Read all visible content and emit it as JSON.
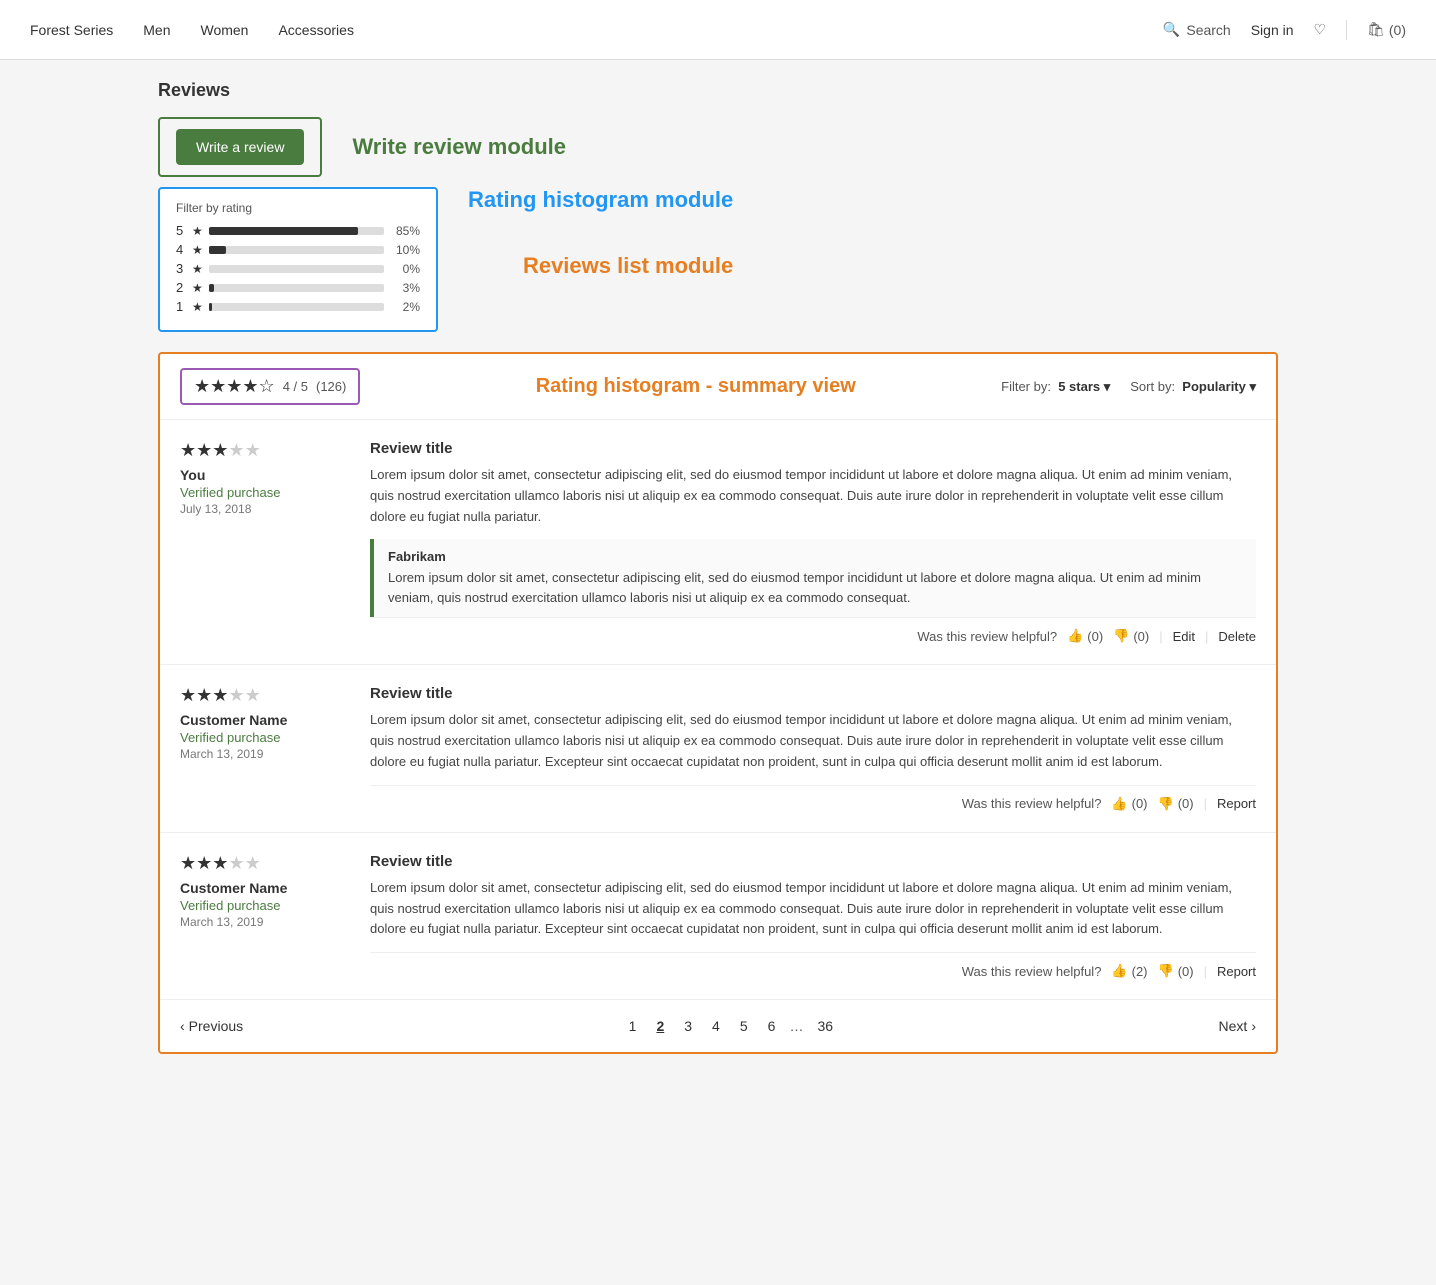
{
  "nav": {
    "links": [
      "Forest Series",
      "Men",
      "Women",
      "Accessories"
    ],
    "search_label": "Search",
    "signin_label": "Sign in",
    "cart_label": "(0)"
  },
  "page": {
    "title": "Reviews"
  },
  "write_review_module": {
    "label": "Write review module",
    "button_label": "Write a review"
  },
  "rating_histogram_module": {
    "label": "Rating histogram module",
    "filter_label": "Filter by rating",
    "rows": [
      {
        "star": "5",
        "pct_val": 85,
        "pct_label": "85%"
      },
      {
        "star": "4",
        "pct_val": 10,
        "pct_label": "10%"
      },
      {
        "star": "3",
        "pct_val": 0,
        "pct_label": "0%"
      },
      {
        "star": "2",
        "pct_val": 3,
        "pct_label": "3%"
      },
      {
        "star": "1",
        "pct_val": 2,
        "pct_label": "2%"
      }
    ]
  },
  "reviews_list_module": {
    "label": "Reviews list module",
    "summary_label": "Rating histogram - summary view",
    "summary_rating": "4 / 5",
    "summary_count": "(126)",
    "filter_by_label": "Filter by:",
    "filter_value": "5 stars ▾",
    "sort_by_label": "Sort by:",
    "sort_value": "Popularity ▾",
    "reviews": [
      {
        "stars_filled": 3,
        "stars_total": 5,
        "reviewer": "You",
        "verified": "Verified purchase",
        "date": "July 13, 2018",
        "title": "Review title",
        "text": "Lorem ipsum dolor sit amet, consectetur adipiscing elit, sed do eiusmod tempor incididunt ut labore et dolore magna aliqua. Ut enim ad minim veniam, quis nostrud exercitation ullamco laboris nisi ut aliquip ex ea commodo consequat. Duis aute irure dolor in reprehenderit in voluptate velit esse cillum dolore eu fugiat nulla pariatur.",
        "helpful_text": "Was this review helpful?",
        "thumbs_up": "0",
        "thumbs_down": "0",
        "actions": [
          "Edit",
          "Delete"
        ],
        "response": {
          "name": "Fabrikam",
          "text": "Lorem ipsum dolor sit amet, consectetur adipiscing elit, sed do eiusmod tempor incididunt ut labore et dolore magna aliqua. Ut enim ad minim veniam, quis nostrud exercitation ullamco laboris nisi ut aliquip ex ea commodo consequat."
        }
      },
      {
        "stars_filled": 3,
        "stars_total": 5,
        "reviewer": "Customer Name",
        "verified": "Verified purchase",
        "date": "March 13, 2019",
        "title": "Review title",
        "text": "Lorem ipsum dolor sit amet, consectetur adipiscing elit, sed do eiusmod tempor incididunt ut labore et dolore magna aliqua. Ut enim ad minim veniam, quis nostrud exercitation ullamco laboris nisi ut aliquip ex ea commodo consequat. Duis aute irure dolor in reprehenderit in voluptate velit esse cillum dolore eu fugiat nulla pariatur. Excepteur sint occaecat cupidatat non proident, sunt in culpa qui officia deserunt mollit anim id est laborum.",
        "helpful_text": "Was this review helpful?",
        "thumbs_up": "0",
        "thumbs_down": "0",
        "actions": [
          "Report"
        ],
        "response": null
      },
      {
        "stars_filled": 3,
        "stars_total": 5,
        "reviewer": "Customer Name",
        "verified": "Verified purchase",
        "date": "March 13, 2019",
        "title": "Review title",
        "text": "Lorem ipsum dolor sit amet, consectetur adipiscing elit, sed do eiusmod tempor incididunt ut labore et dolore magna aliqua. Ut enim ad minim veniam, quis nostrud exercitation ullamco laboris nisi ut aliquip ex ea commodo consequat. Duis aute irure dolor in reprehenderit in voluptate velit esse cillum dolore eu fugiat nulla pariatur. Excepteur sint occaecat cupidatat non proident, sunt in culpa qui officia deserunt mollit anim id est laborum.",
        "helpful_text": "Was this review helpful?",
        "thumbs_up": "2",
        "thumbs_down": "0",
        "actions": [
          "Report"
        ],
        "response": null
      }
    ],
    "pagination": {
      "prev_label": "Previous",
      "next_label": "Next",
      "pages": [
        "1",
        "2",
        "3",
        "4",
        "5",
        "6",
        "...",
        "36"
      ],
      "active_page": "2"
    }
  }
}
